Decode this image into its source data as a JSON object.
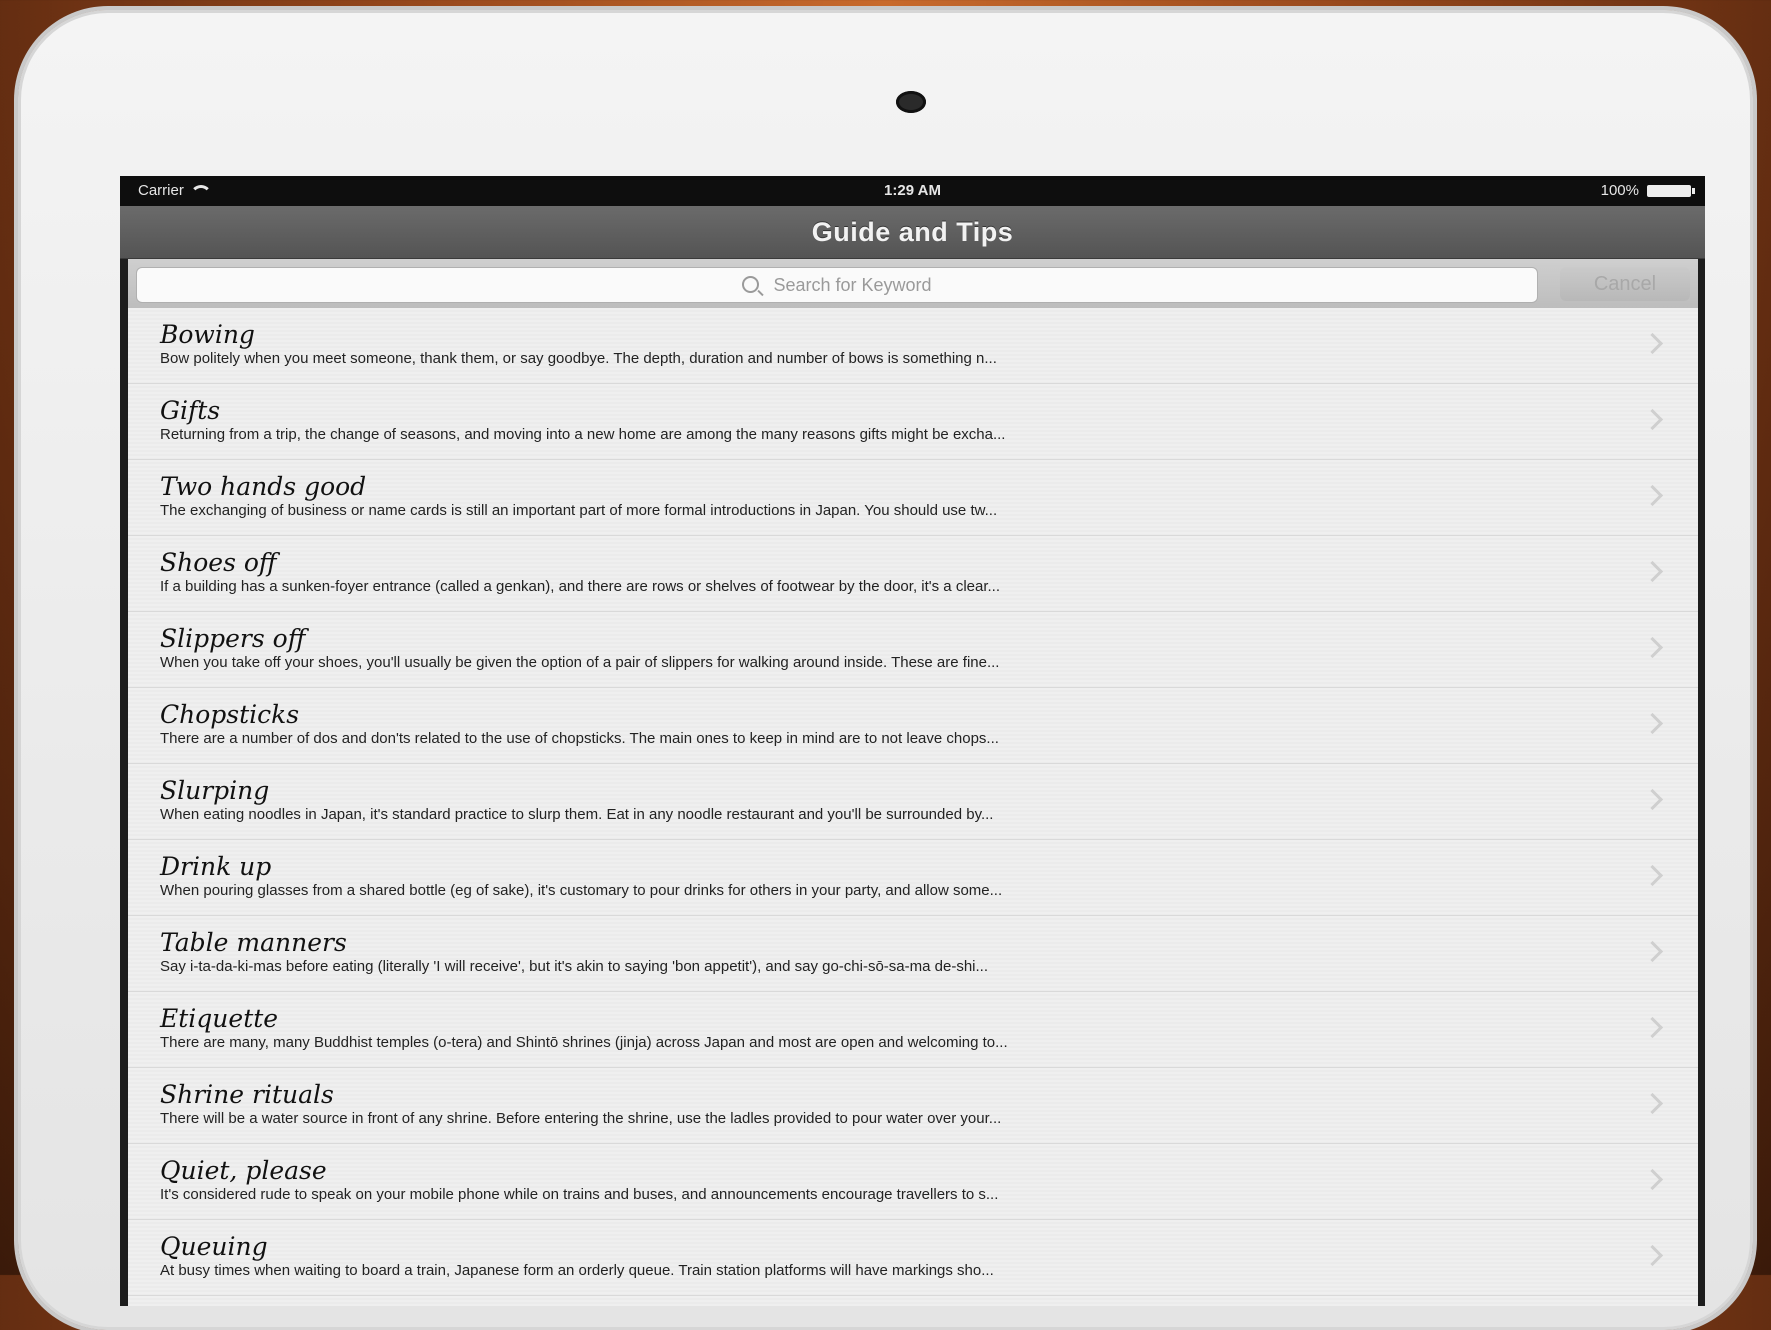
{
  "status_bar": {
    "carrier": "Carrier",
    "time": "1:29 AM",
    "battery": "100%"
  },
  "nav": {
    "title": "Guide and Tips"
  },
  "search": {
    "placeholder": "Search for Keyword",
    "cancel_label": "Cancel"
  },
  "items": [
    {
      "title": "Bowing",
      "desc": "Bow politely when you meet someone, thank them, or say goodbye. The depth, duration and number of bows is something n..."
    },
    {
      "title": "Gifts",
      "desc": "Returning from a trip, the change of seasons, and moving into a new home are among the many reasons gifts might be excha..."
    },
    {
      "title": "Two hands good",
      "desc": "The exchanging of business or name cards is still an important part of more formal introductions in Japan. You should use tw..."
    },
    {
      "title": "Shoes off",
      "desc": "If a building has a sunken-foyer entrance (called a genkan), and there are rows or shelves of footwear by the door, it's a clear..."
    },
    {
      "title": "Slippers off",
      "desc": "When you take off your shoes, you'll usually be given the option of a pair of slippers for walking around inside. These are fine..."
    },
    {
      "title": "Chopsticks",
      "desc": "There are a number of dos and don'ts related to the use of chopsticks. The main ones to keep in mind are to not leave chops..."
    },
    {
      "title": "Slurping",
      "desc": "When eating noodles in Japan, it's standard practice to slurp them. Eat in any noodle restaurant and you'll be surrounded by..."
    },
    {
      "title": "Drink up",
      "desc": "When pouring glasses from a shared bottle (eg of sake), it's customary to pour drinks for others in your party, and allow some..."
    },
    {
      "title": "Table manners",
      "desc": "Say i-ta-da-ki-mas before eating (literally 'I will receive', but it's akin to saying 'bon appetit'), and say go-chi-sō-sa-ma de-shi..."
    },
    {
      "title": "Etiquette",
      "desc": "There are many, many Buddhist temples (o-tera) and Shintō shrines (jinja) across Japan and most are open and welcoming to..."
    },
    {
      "title": "Shrine rituals",
      "desc": "There will be a water source in front of any shrine. Before entering the shrine, use the ladles provided to pour water over your..."
    },
    {
      "title": "Quiet, please",
      "desc": "It's considered rude to speak on your mobile phone while on trains and buses, and announcements encourage travellers to s..."
    },
    {
      "title": "Queuing",
      "desc": "At busy times when waiting to board a train, Japanese form an orderly queue. Train station platforms will have markings sho..."
    }
  ]
}
